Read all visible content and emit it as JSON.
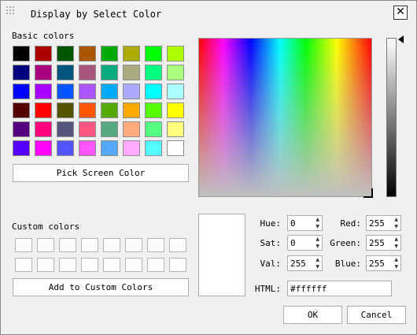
{
  "window": {
    "title": "Display by Select Color",
    "close_glyph": "✕"
  },
  "basic_colors": {
    "label": "Basic colors",
    "swatches": [
      "#000000",
      "#aa0000",
      "#005500",
      "#aa5500",
      "#00aa00",
      "#aaaa00",
      "#00ff00",
      "#aaff00",
      "#00007f",
      "#aa007f",
      "#00557f",
      "#aa557f",
      "#00aa7f",
      "#aaaa7f",
      "#00ff7f",
      "#aaff7f",
      "#0000ff",
      "#aa00ff",
      "#0055ff",
      "#aa55ff",
      "#00aaff",
      "#aaaaff",
      "#00ffff",
      "#aaffff",
      "#550000",
      "#ff0000",
      "#555500",
      "#ff5500",
      "#55aa00",
      "#ffaa00",
      "#55ff00",
      "#ffff00",
      "#55007f",
      "#ff007f",
      "#55557f",
      "#ff557f",
      "#55aa7f",
      "#ffaa7f",
      "#55ff7f",
      "#ffff7f",
      "#5500ff",
      "#ff00ff",
      "#5555ff",
      "#ff55ff",
      "#55aaff",
      "#ffaaff",
      "#55ffff",
      "#ffffff"
    ]
  },
  "pick_screen_button": "Pick Screen Color",
  "custom_colors": {
    "label": "Custom colors",
    "count": 16
  },
  "add_custom_button": "Add to Custom Colors",
  "fields": {
    "hue": {
      "label": "Hue:",
      "value": "0"
    },
    "sat": {
      "label": "Sat:",
      "value": "0"
    },
    "val": {
      "label": "Val:",
      "value": "255"
    },
    "red": {
      "label": "Red:",
      "value": "255"
    },
    "green": {
      "label": "Green:",
      "value": "255"
    },
    "blue": {
      "label": "Blue:",
      "value": "255"
    },
    "html": {
      "label": "HTML:",
      "value": "#ffffff"
    }
  },
  "preview_color": "#ffffff",
  "ok_button": "OK",
  "cancel_button": "Cancel"
}
